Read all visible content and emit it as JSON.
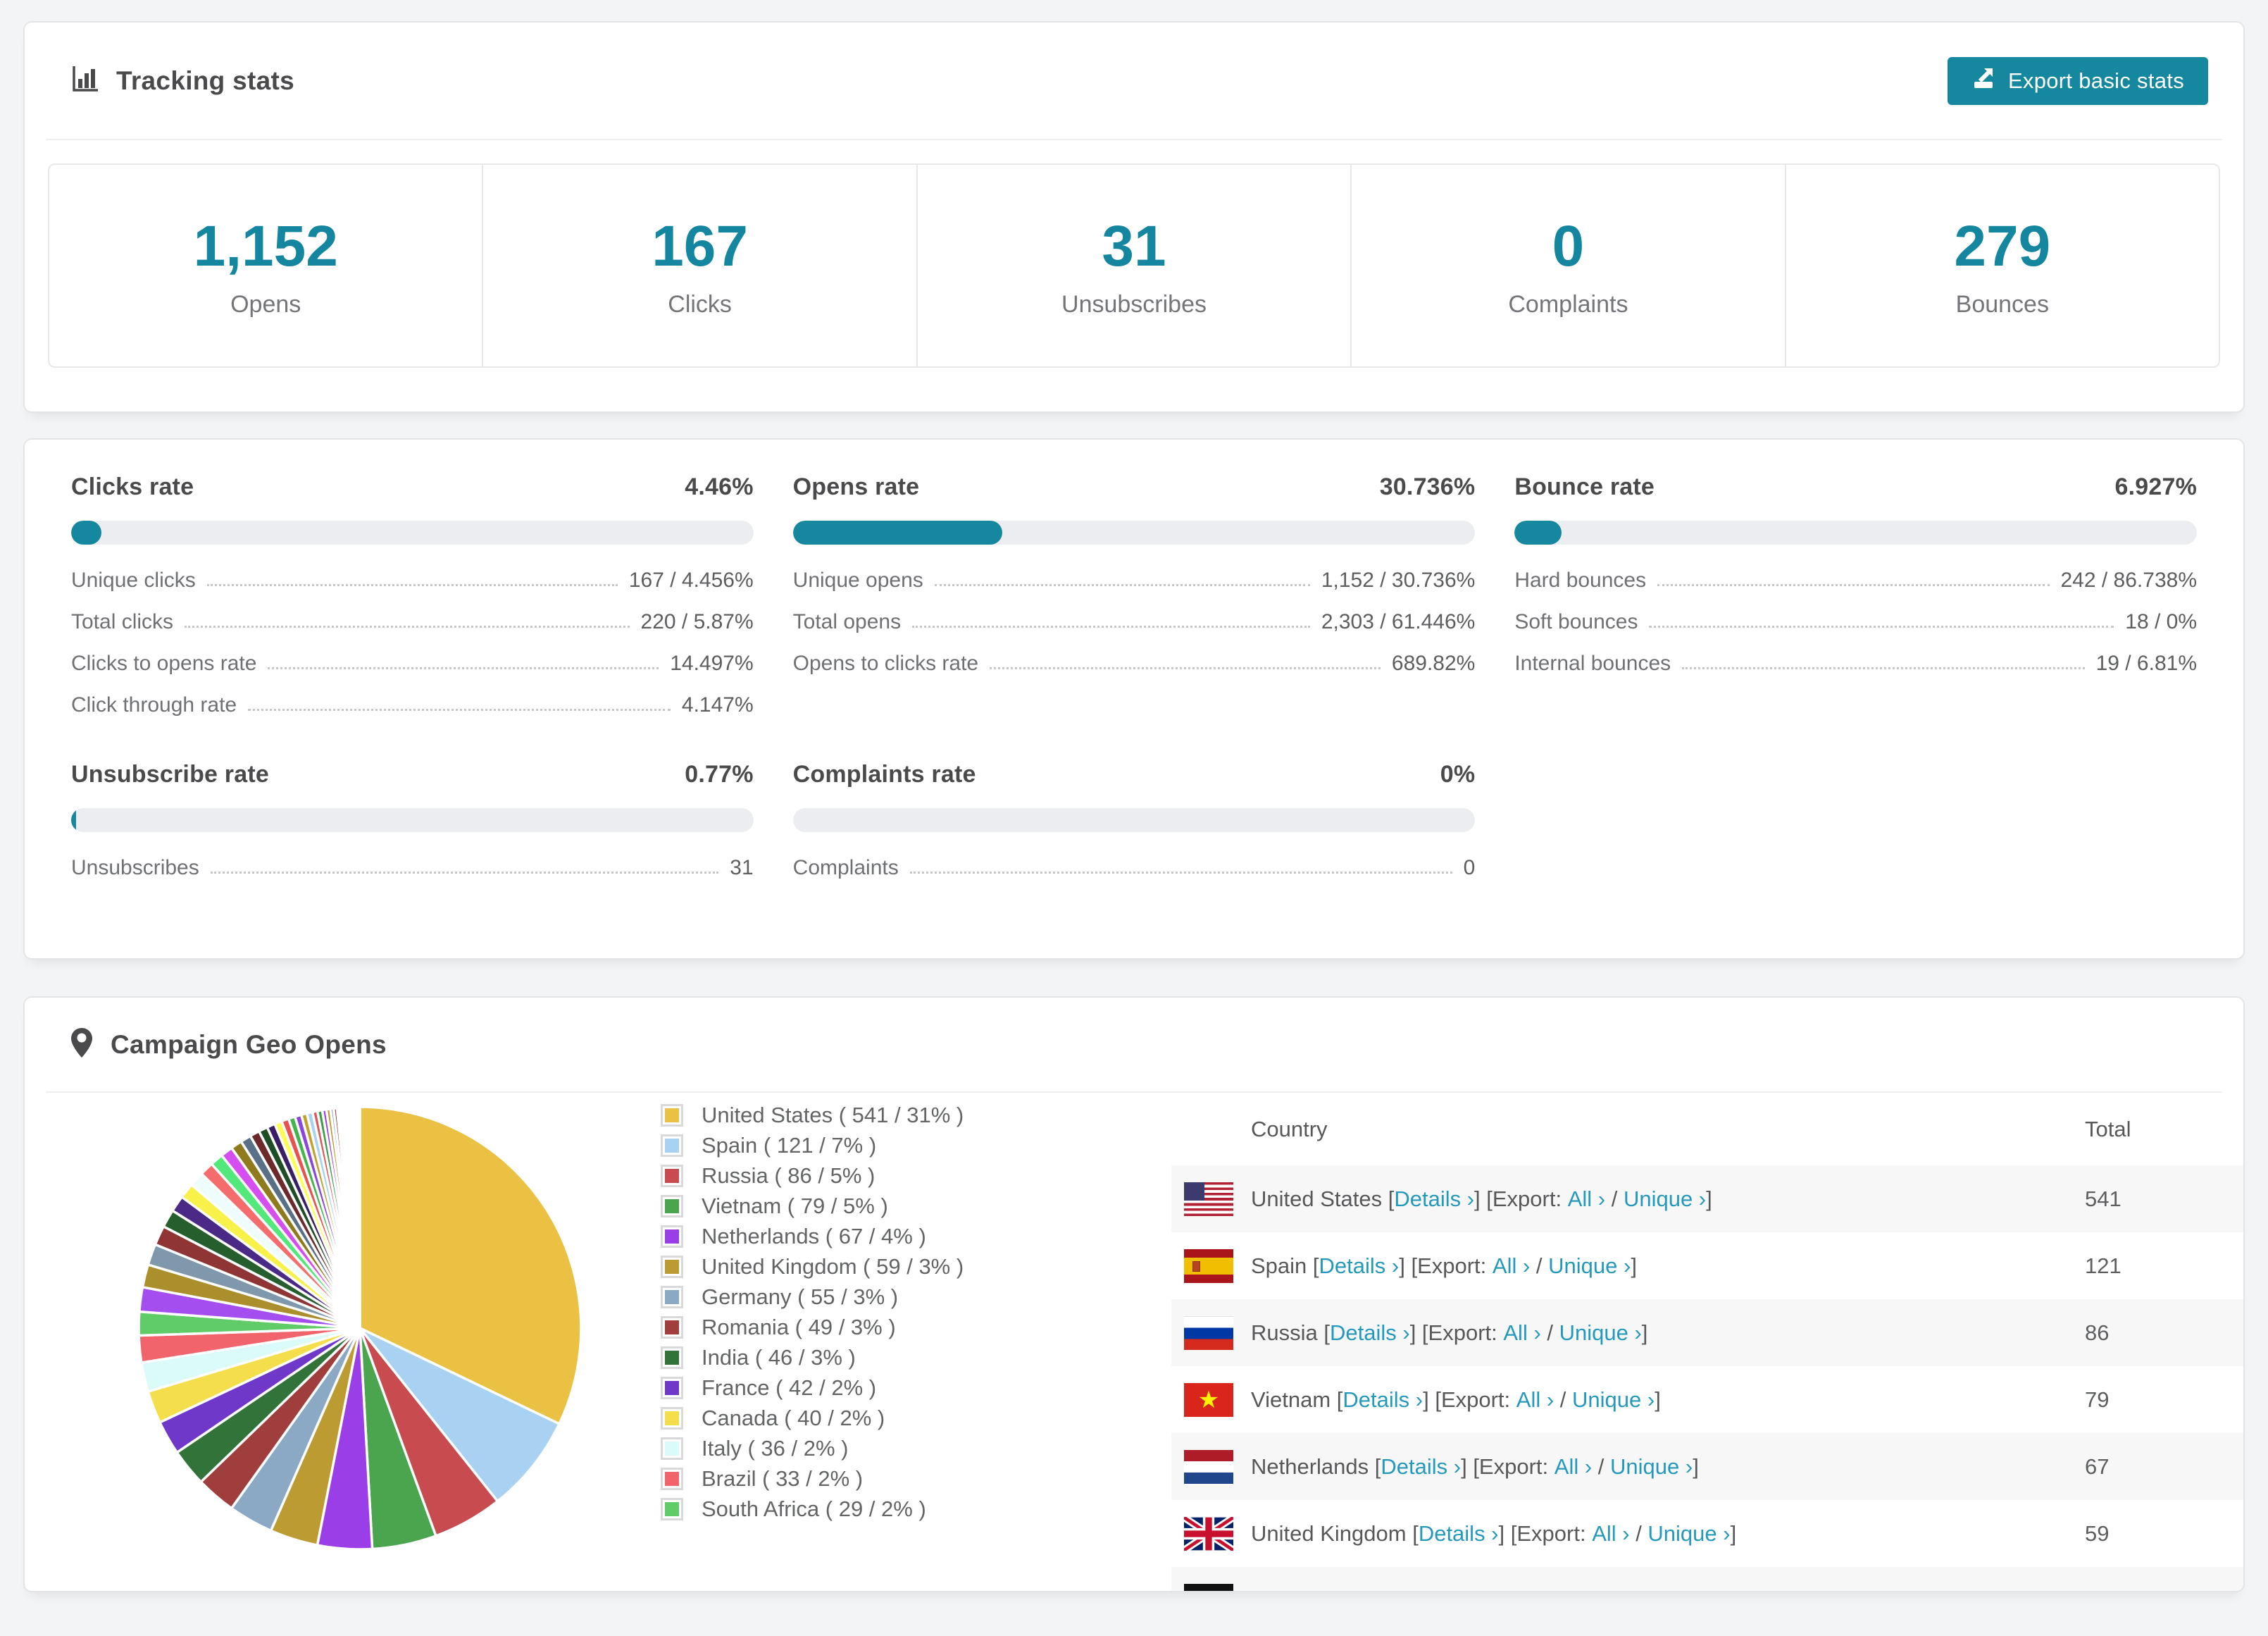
{
  "theme": {
    "accent": "#15879f",
    "stat_number_color": "#1486a0",
    "link_color": "#2499bd",
    "bar_track": "#ebedf0"
  },
  "tracking_stats": {
    "title": "Tracking stats",
    "export_button": "Export basic stats",
    "summary": [
      {
        "value": "1,152",
        "label": "Opens"
      },
      {
        "value": "167",
        "label": "Clicks"
      },
      {
        "value": "31",
        "label": "Unsubscribes"
      },
      {
        "value": "0",
        "label": "Complaints"
      },
      {
        "value": "279",
        "label": "Bounces"
      }
    ]
  },
  "rates": {
    "panels": [
      {
        "title": "Clicks rate",
        "value": "4.46%",
        "percent": 4.46,
        "rows": [
          {
            "label": "Unique clicks",
            "value": "167 / 4.456%"
          },
          {
            "label": "Total clicks",
            "value": "220 / 5.87%"
          },
          {
            "label": "Clicks to opens rate",
            "value": "14.497%"
          },
          {
            "label": "Click through rate",
            "value": "4.147%"
          }
        ]
      },
      {
        "title": "Opens rate",
        "value": "30.736%",
        "percent": 30.736,
        "rows": [
          {
            "label": "Unique opens",
            "value": "1,152 / 30.736%"
          },
          {
            "label": "Total opens",
            "value": "2,303 / 61.446%"
          },
          {
            "label": "Opens to clicks rate",
            "value": "689.82%"
          }
        ]
      },
      {
        "title": "Bounce rate",
        "value": "6.927%",
        "percent": 6.927,
        "rows": [
          {
            "label": "Hard bounces",
            "value": "242 / 86.738%"
          },
          {
            "label": "Soft bounces",
            "value": "18 / 0%"
          },
          {
            "label": "Internal bounces",
            "value": "19 / 6.81%"
          }
        ]
      },
      {
        "title": "Unsubscribe rate",
        "value": "0.77%",
        "percent": 0.77,
        "rows": [
          {
            "label": "Unsubscribes",
            "value": "31"
          }
        ]
      },
      {
        "title": "Complaints rate",
        "value": "0%",
        "percent": 0,
        "rows": [
          {
            "label": "Complaints",
            "value": "0"
          }
        ]
      }
    ]
  },
  "geo": {
    "title": "Campaign Geo Opens",
    "chart_data": {
      "type": "pie",
      "title": "Campaign Geo Opens",
      "legend_position": "right",
      "slices": [
        {
          "label": "United States",
          "value": 541,
          "pct": "31%",
          "color": "#EAC143",
          "legend": "United States ( 541 / 31% )"
        },
        {
          "label": "Spain",
          "value": 121,
          "pct": "7%",
          "color": "#A9D2F2",
          "legend": "Spain ( 121 / 7% )"
        },
        {
          "label": "Russia",
          "value": 86,
          "pct": "5%",
          "color": "#C74B4F",
          "legend": "Russia ( 86 / 5% )"
        },
        {
          "label": "Vietnam",
          "value": 79,
          "pct": "5%",
          "color": "#4AA54E",
          "legend": "Vietnam ( 79 / 5% )"
        },
        {
          "label": "Netherlands",
          "value": 67,
          "pct": "4%",
          "color": "#9A3FE8",
          "legend": "Netherlands ( 67 / 4% )"
        },
        {
          "label": "United Kingdom",
          "value": 59,
          "pct": "3%",
          "color": "#BD9B33",
          "legend": "United Kingdom ( 59 / 3% )"
        },
        {
          "label": "Germany",
          "value": 55,
          "pct": "3%",
          "color": "#8BA9C4",
          "legend": "Germany ( 55 / 3% )"
        },
        {
          "label": "Romania",
          "value": 49,
          "pct": "3%",
          "color": "#A03D3D",
          "legend": "Romania ( 49 / 3% )"
        },
        {
          "label": "India",
          "value": 46,
          "pct": "3%",
          "color": "#317339",
          "legend": "India ( 46 / 3% )"
        },
        {
          "label": "France",
          "value": 42,
          "pct": "2%",
          "color": "#7038C8",
          "legend": "France ( 42 / 2% )"
        },
        {
          "label": "Canada",
          "value": 40,
          "pct": "2%",
          "color": "#F5DE4B",
          "legend": "Canada ( 40 / 2% )"
        },
        {
          "label": "Italy",
          "value": 36,
          "pct": "2%",
          "color": "#DAFBFA",
          "legend": "Italy ( 36 / 2% )"
        },
        {
          "label": "Brazil",
          "value": 33,
          "pct": "2%",
          "color": "#F2646C",
          "legend": "Brazil ( 33 / 2% )"
        },
        {
          "label": "South Africa",
          "value": 29,
          "pct": "2%",
          "color": "#60CC68",
          "legend": "South Africa ( 29 / 2% )"
        }
      ],
      "others": {
        "note": "many small unlabeled country slices",
        "values": [
          30,
          28,
          26,
          24,
          22,
          20,
          19,
          18,
          17,
          16,
          15,
          14,
          13,
          12,
          11,
          10,
          9,
          9,
          8,
          8,
          7,
          7,
          6,
          6,
          5,
          5,
          4,
          4,
          3,
          3,
          3,
          2,
          2,
          2,
          2,
          2,
          1,
          1,
          1,
          1,
          1,
          1,
          1,
          1,
          1
        ],
        "colors": [
          "#a44ef0",
          "#ab8f2c",
          "#7f98ab",
          "#8f3535",
          "#275e2e",
          "#4a2a86",
          "#f8f14a",
          "#eefcfc",
          "#f56c6c",
          "#52e87a",
          "#d44ef0",
          "#8f7a1e",
          "#5a7086",
          "#6e2a2a",
          "#1e4d26",
          "#3a1f66",
          "#fdfd55",
          "#e8524f",
          "#44b54c",
          "#8a46e0",
          "#c3a02e",
          "#a8d3f0",
          "#e05555",
          "#3f9d49",
          "#9a3fe8",
          "#bd9b33",
          "#8ba9c4",
          "#a03d3d",
          "#317339",
          "#7038c8",
          "#f5de4b",
          "#dafbfa",
          "#f2646c",
          "#60cc68",
          "#eac143",
          "#a8d3f0",
          "#c94c4e",
          "#4aa54e",
          "#9a3fe8",
          "#bd9b33",
          "#8ba9c4",
          "#a03d3d",
          "#317339",
          "#7038c8",
          "#f5de4b"
        ]
      }
    },
    "table": {
      "country_header": "Country",
      "total_header": "Total",
      "fragments": {
        "bracket_open": " [",
        "details": "Details ›",
        "mid": "] [Export: ",
        "all": "All ›",
        "slash": " / ",
        "unique": "Unique ›",
        "bracket_close": "]"
      },
      "rows": [
        {
          "country": "United States",
          "total": "541",
          "flag": "us"
        },
        {
          "country": "Spain",
          "total": "121",
          "flag": "es"
        },
        {
          "country": "Russia",
          "total": "86",
          "flag": "ru"
        },
        {
          "country": "Vietnam",
          "total": "79",
          "flag": "vn"
        },
        {
          "country": "Netherlands",
          "total": "67",
          "flag": "nl"
        },
        {
          "country": "United Kingdom",
          "total": "59",
          "flag": "gb"
        }
      ],
      "partial_row": {
        "flag": "de"
      }
    }
  }
}
